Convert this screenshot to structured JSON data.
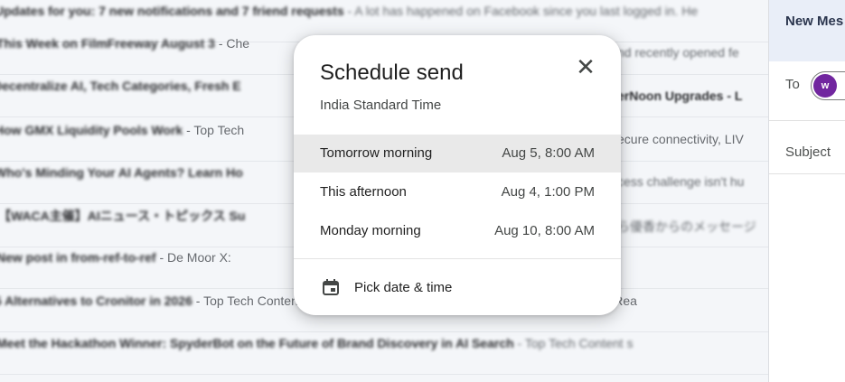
{
  "inbox": {
    "rows": [
      {
        "subject": "Updates for you: 7 new notifications and 7 friend requests",
        "snippet": " - A lot has happened on Facebook since you last logged in. He",
        "clear": ""
      },
      {
        "subject": "This Week on FilmFreeway August 3",
        "snippet": "",
        "clear": " - Che"
      },
      {
        "subject": "Decentralize AI, Tech Categories, Fresh E",
        "snippet": "",
        "clear": ""
      },
      {
        "subject": "How GMX Liquidity Pools Work",
        "snippet": "",
        "clear": " - Top Tech"
      },
      {
        "subject": "Who's Minding Your AI Agents? Learn Ho",
        "snippet": "",
        "clear": ""
      },
      {
        "subject": "【WACA主催】AIニュース・トピックス Su",
        "snippet": "",
        "clear": ""
      },
      {
        "subject": "New post in from-ref-to-ref",
        "snippet": " - De Moor X:",
        "clear": ""
      },
      {
        "subject": "5 Alternatives to Cronitor in 2026",
        "snippet": "",
        "clear": " - Top Tech Content sent at Noon: Guide to Phishing-Resistant FIDO2 MFA Rea"
      },
      {
        "subject": "Meet the Hackathon Winner: SpyderBot on the Future of Brand Discovery in AI Search",
        "snippet": " - Top Tech Content s",
        "clear": ""
      }
    ]
  },
  "right_fragments": [
    {
      "text": "nd recently opened fe"
    },
    {
      "text": "erNoon Upgrades - L"
    },
    {
      "text": "ecure connectivity, LIV"
    },
    {
      "text": "cess challenge isn't hu"
    },
    {
      "text": "ら優香からのメッセージ"
    }
  ],
  "compose": {
    "title": "New Mes",
    "to_label": "To",
    "avatar_letter": "w",
    "subject_label": "Subject"
  },
  "dialog": {
    "title": "Schedule send",
    "close_glyph": "✕",
    "timezone": "India Standard Time",
    "options": [
      {
        "label": "Tomorrow morning",
        "time": "Aug 5, 8:00 AM",
        "selected": true
      },
      {
        "label": "This afternoon",
        "time": "Aug 4, 1:00 PM",
        "selected": false
      },
      {
        "label": "Monday morning",
        "time": "Aug 10, 8:00 AM",
        "selected": false
      }
    ],
    "pick_label": "Pick date & time",
    "pick_icon": "calendar-icon"
  },
  "colors": {
    "avatar": "#6a1b9a",
    "selected_row": "#e9e9e9",
    "compose_header": "#e8eef8"
  }
}
